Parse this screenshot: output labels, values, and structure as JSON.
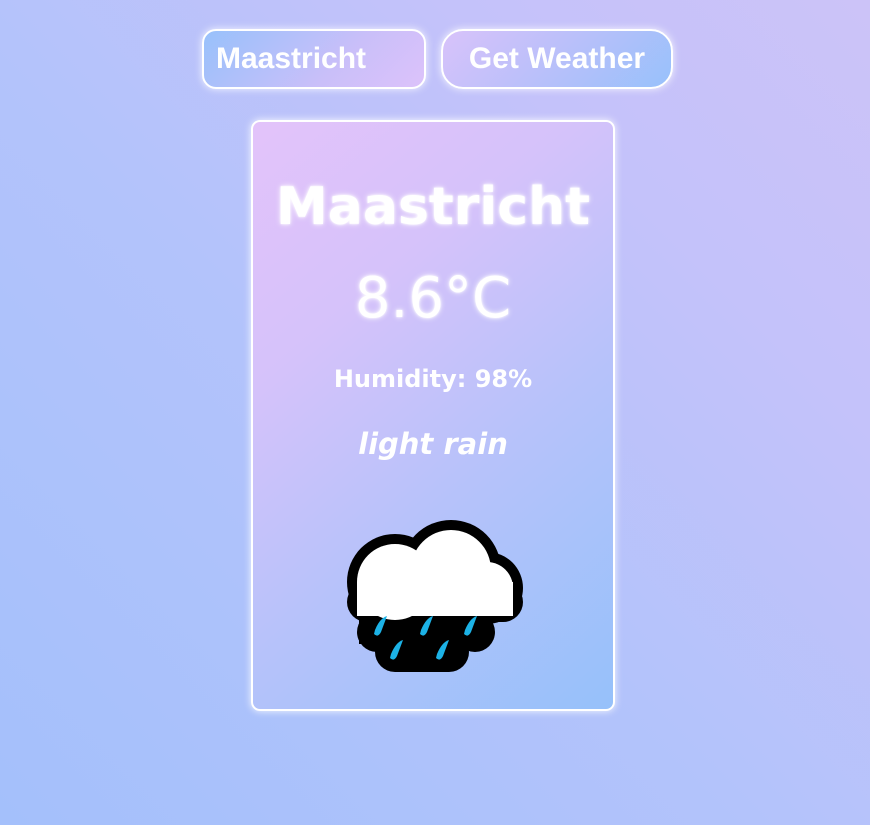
{
  "search": {
    "input_value": "Maastricht",
    "button_label": "Get Weather"
  },
  "weather": {
    "city": "Maastricht",
    "temperature": "8.6°C",
    "humidity": "Humidity: 98%",
    "description": "light rain",
    "icon": "rain-cloud-icon"
  },
  "colors": {
    "raindrop": "#1cb2e6",
    "cloud": "#ffffff",
    "outline": "#000000"
  }
}
